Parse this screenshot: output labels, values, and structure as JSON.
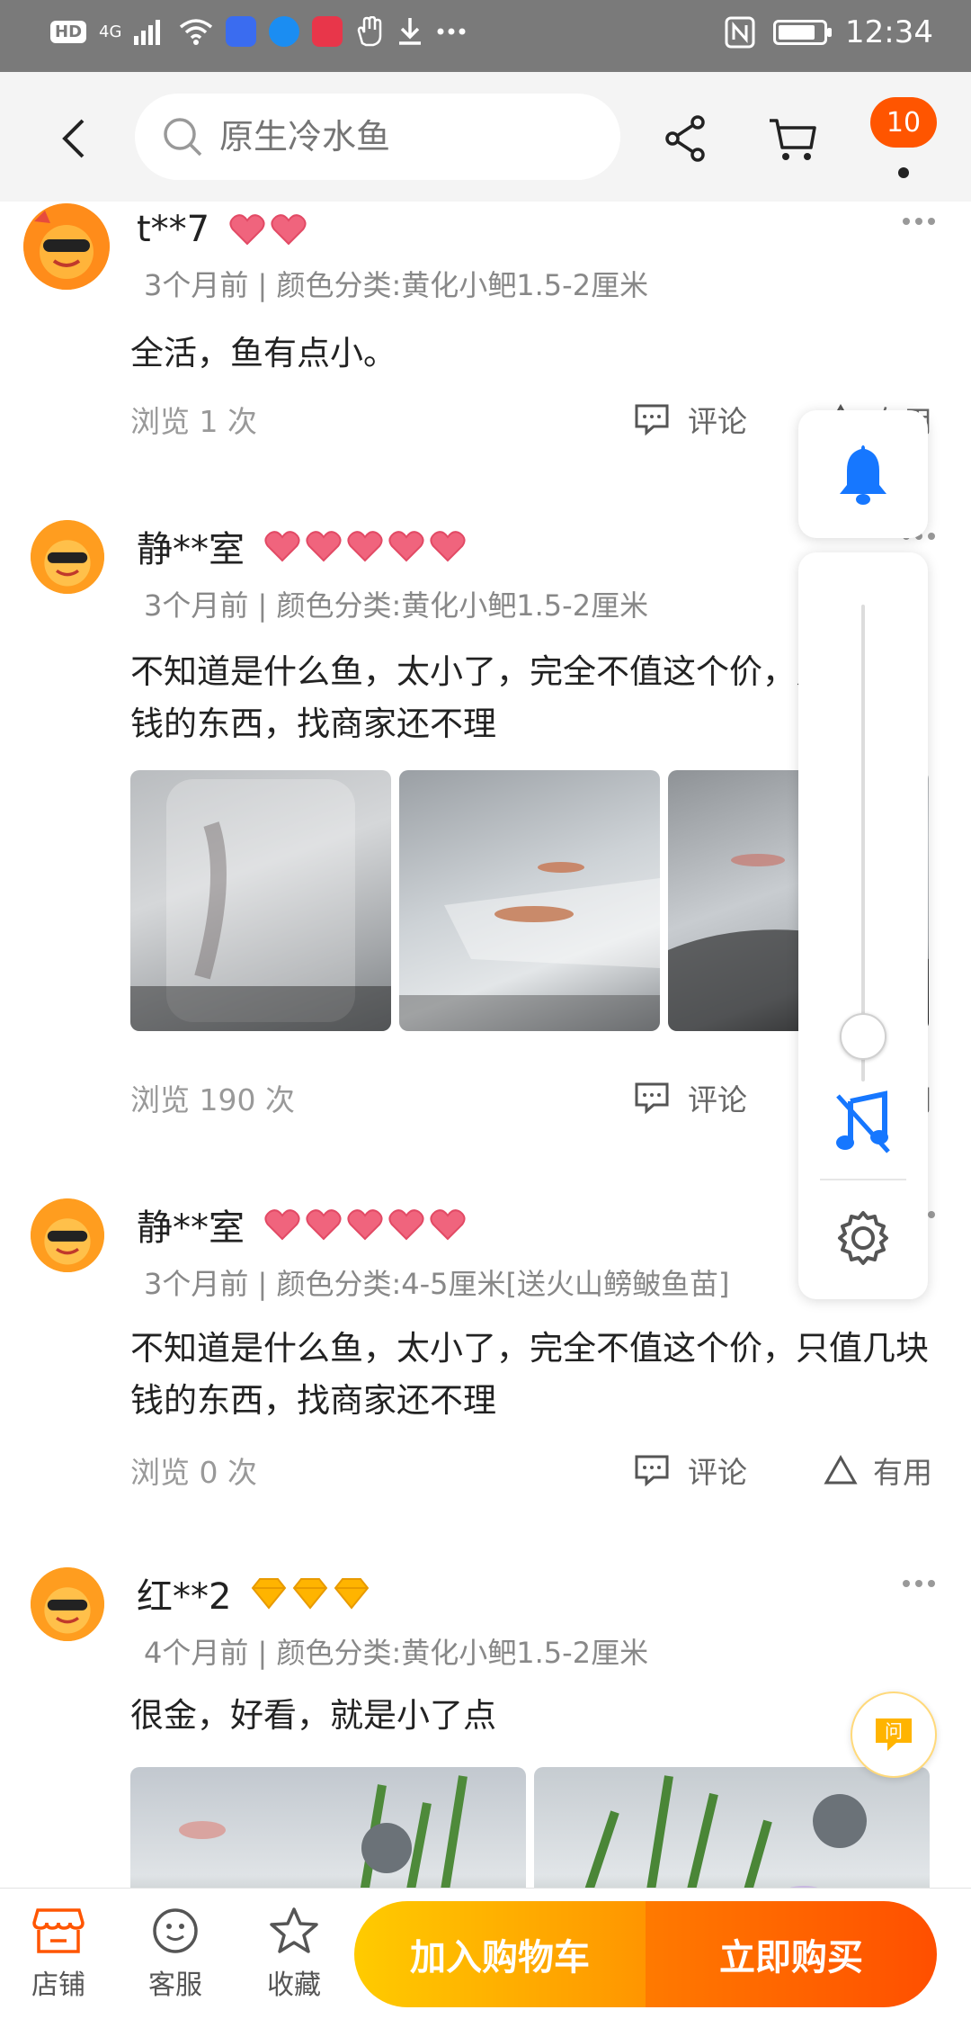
{
  "status_bar": {
    "hd": "HD",
    "network": "4G",
    "time": "12:34"
  },
  "header": {
    "search_placeholder": "原生冷水鱼",
    "notification_count": "10"
  },
  "reviews": [
    {
      "user": "t**7",
      "level_icons": 2,
      "meta": "3个月前 | 颜色分类:黄化小鲃1.5-2厘米",
      "content": "全活，鱼有点小。",
      "views": "浏览 1 次",
      "comment_label": "评论",
      "useful_label": "有用"
    },
    {
      "user": "静**室",
      "level_icons": 5,
      "meta": "3个月前 | 颜色分类:黄化小鲃1.5-2厘米",
      "content": "不知道是什么鱼，太小了，完全不值这个价，只值几块钱的东西，找商家还不理",
      "views": "浏览 190 次",
      "comment_label": "评论",
      "useful_label": "有用"
    },
    {
      "user": "静**室",
      "level_icons": 5,
      "meta": "3个月前 | 颜色分类:4-5厘米[送火山鳑鲏鱼苗]",
      "content": "不知道是什么鱼，太小了，完全不值这个价，只值几块钱的东西，找商家还不理",
      "views": "浏览 0 次",
      "comment_label": "评论",
      "useful_label": "有用"
    },
    {
      "user": "红**2",
      "level_icons": 3,
      "meta": "4个月前 | 颜色分类:黄化小鲃1.5-2厘米",
      "content": "很金，好看，就是小了点"
    }
  ],
  "colors": {
    "accent": "#ff5500",
    "heart": "#f0647d",
    "diamond": "#ffb400",
    "panel_blue": "#1677ff"
  },
  "ask_label": "问",
  "bottom_bar": {
    "shop_label": "店铺",
    "service_label": "客服",
    "favorite_label": "收藏",
    "add_to_cart": "加入购物车",
    "buy_now": "立即购买"
  }
}
